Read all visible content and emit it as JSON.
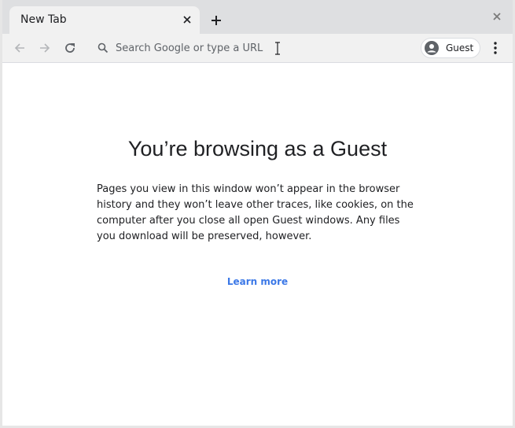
{
  "tab": {
    "title": "New Tab"
  },
  "toolbar": {
    "omnibox_placeholder": "Search Google or type a URL",
    "omnibox_value": "",
    "profile_label": "Guest"
  },
  "icons": {
    "tab_close": "close-icon",
    "new_tab": "plus-icon",
    "window_close": "close-icon",
    "back": "arrow-left-icon",
    "forward": "arrow-right-icon",
    "reload": "reload-icon",
    "search": "search-icon",
    "avatar": "account-circle-icon",
    "menu": "more-vert-icon"
  },
  "page": {
    "heading": "You’re browsing as a Guest",
    "description": "Pages you view in this window won’t appear in the browser history and they won’t leave other traces, like cookies, on the computer after you close all open Guest windows. Any files you download will be preserved, however.",
    "learn_more": "Learn more"
  },
  "colors": {
    "link": "#3b78e7",
    "tabstrip": "#dedfe1",
    "toolbar": "#f1f1f1"
  }
}
